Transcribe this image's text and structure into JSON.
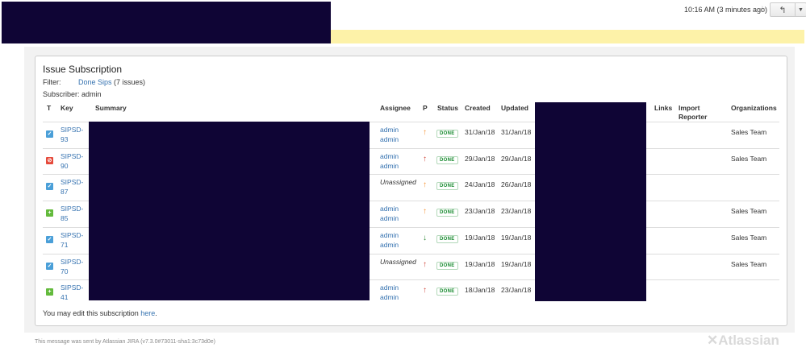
{
  "header": {
    "timestamp": "10:16 AM (3 minutes ago)",
    "star_icon": "star-icon",
    "reply_icon": "reply-icon",
    "more_icon": "chevron-down-icon"
  },
  "subscription": {
    "title": "Issue Subscription",
    "filter_label": "Filter:",
    "filter_name": "Done Sips",
    "filter_count": "(7 issues)",
    "subscriber_label": "Subscriber:",
    "subscriber_name": "admin"
  },
  "table": {
    "columns": [
      "T",
      "Key",
      "Summary",
      "Assignee",
      "P",
      "Status",
      "Created",
      "Updated",
      "Links",
      "Import Reporter",
      "Organizations"
    ],
    "rows": [
      {
        "type": "task",
        "key_line1": "SIPSD-",
        "key_line2": "93",
        "assignee1": "admin",
        "assignee2": "admin",
        "priority": "medium",
        "status": "DONE",
        "created": "31/Jan/18",
        "updated": "31/Jan/18",
        "organization": "Sales Team"
      },
      {
        "type": "bug",
        "key_line1": "SIPSD-",
        "key_line2": "90",
        "assignee1": "admin",
        "assignee2": "admin",
        "priority": "high",
        "status": "DONE",
        "created": "29/Jan/18",
        "updated": "29/Jan/18",
        "organization": "Sales Team"
      },
      {
        "type": "task",
        "key_line1": "SIPSD-",
        "key_line2": "87",
        "assignee1": "Unassigned",
        "assignee2": "",
        "priority": "medium",
        "status": "DONE",
        "created": "24/Jan/18",
        "updated": "26/Jan/18",
        "organization": ""
      },
      {
        "type": "new-feature",
        "key_line1": "SIPSD-",
        "key_line2": "85",
        "assignee1": "admin",
        "assignee2": "admin",
        "priority": "medium",
        "status": "DONE",
        "created": "23/Jan/18",
        "updated": "23/Jan/18",
        "organization": "Sales Team"
      },
      {
        "type": "task",
        "key_line1": "SIPSD-",
        "key_line2": "71",
        "assignee1": "admin",
        "assignee2": "admin",
        "priority": "low",
        "status": "DONE",
        "created": "19/Jan/18",
        "updated": "19/Jan/18",
        "organization": "Sales Team"
      },
      {
        "type": "task",
        "key_line1": "SIPSD-",
        "key_line2": "70",
        "assignee1": "Unassigned",
        "assignee2": "",
        "priority": "high",
        "status": "DONE",
        "created": "19/Jan/18",
        "updated": "19/Jan/18",
        "organization": "Sales Team"
      },
      {
        "type": "new-feature",
        "key_line1": "SIPSD-",
        "key_line2": "41",
        "assignee1": "admin",
        "assignee2": "admin",
        "priority": "high",
        "status": "DONE",
        "created": "18/Jan/18",
        "updated": "23/Jan/18",
        "organization": ""
      }
    ]
  },
  "edit_note": {
    "prefix": "You may edit this subscription",
    "link": "here",
    "suffix": "."
  },
  "footer": {
    "text": "This message was sent by Atlassian JIRA (v7.3.0#73011-sha1:3c73d0e)",
    "logo_text": "Atlassian"
  }
}
